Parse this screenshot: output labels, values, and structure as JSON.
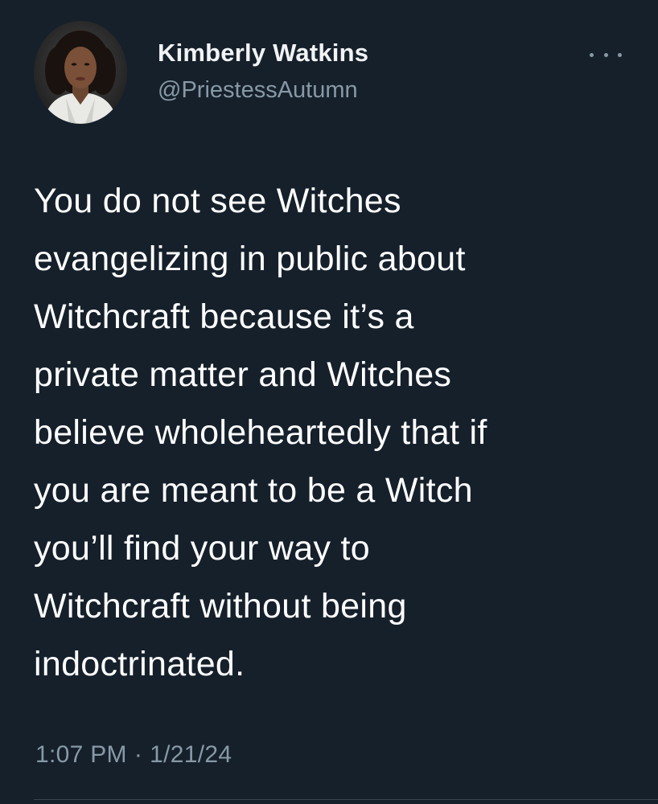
{
  "user": {
    "display_name": "Kimberly Watkins",
    "handle": "@PriestessAutumn"
  },
  "tweet": {
    "text_lines": [
      "You do not see Witches",
      "evangelizing in public about",
      "Witchcraft because it’s a",
      "private matter and Witches",
      "believe wholeheartedly that if",
      "you are meant to be a Witch",
      "you’ll find your way to",
      "Witchcraft without being",
      "indoctrinated."
    ],
    "time": "1:07 PM",
    "separator": "·",
    "date": "1/21/24"
  },
  "icons": {
    "more": "more-horizontal-icon",
    "avatar": "profile-photo"
  },
  "colors": {
    "background": "#15202b",
    "primary_text": "#ffffff",
    "secondary_text": "#8899a6"
  }
}
